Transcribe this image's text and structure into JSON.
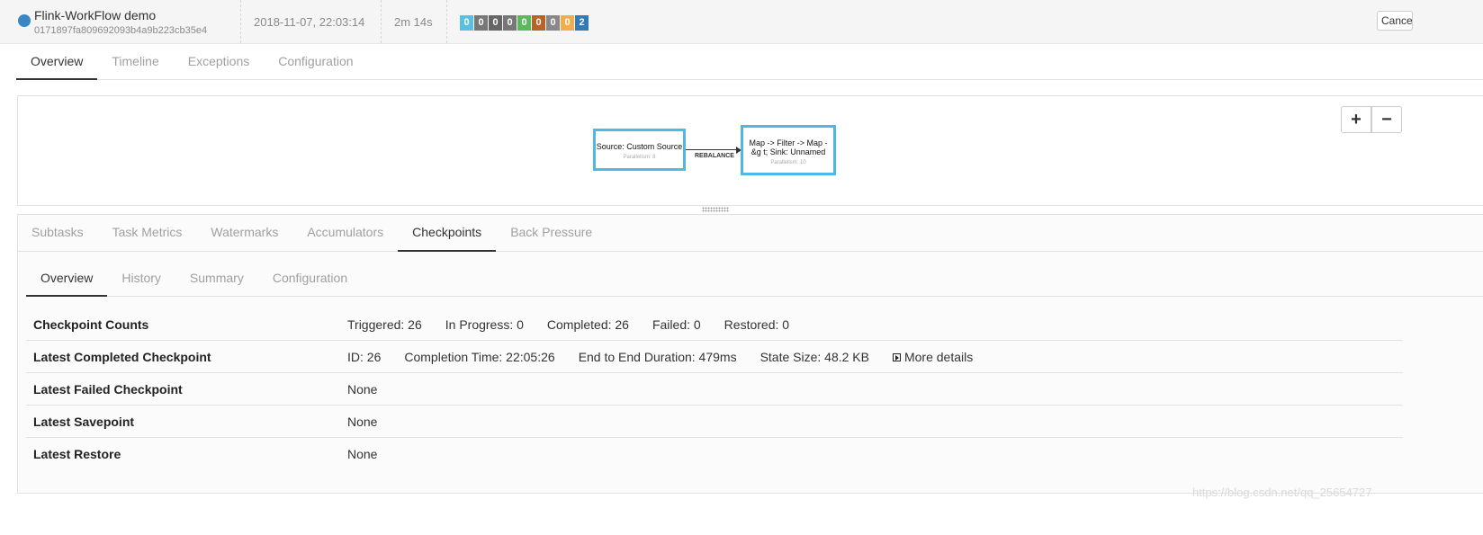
{
  "job": {
    "name": "Flink-WorkFlow demo",
    "id": "0171897fa809692093b4a9b223cb35e4",
    "start_time": "2018-11-07, 22:03:14",
    "duration": "2m 14s",
    "cancel_label": "Cancel",
    "status_color": "#3a87c5",
    "task_counts": [
      {
        "value": "0",
        "color": "#5bc0de"
      },
      {
        "value": "0",
        "color": "#777777"
      },
      {
        "value": "0",
        "color": "#666666"
      },
      {
        "value": "0",
        "color": "#777777"
      },
      {
        "value": "0",
        "color": "#5cb85c"
      },
      {
        "value": "0",
        "color": "#b7622a"
      },
      {
        "value": "0",
        "color": "#888888"
      },
      {
        "value": "0",
        "color": "#f0ad4e"
      },
      {
        "value": "2",
        "color": "#337ab7"
      }
    ]
  },
  "main_tabs": [
    {
      "label": "Overview",
      "active": true
    },
    {
      "label": "Timeline",
      "active": false
    },
    {
      "label": "Exceptions",
      "active": false
    },
    {
      "label": "Configuration",
      "active": false
    }
  ],
  "graph": {
    "zoom_in": "+",
    "zoom_out": "−",
    "nodes": [
      {
        "title": "Source: Custom Source",
        "parallelism": "Parallelism: 8"
      },
      {
        "title": "Map -> Filter -> Map -&g t; Sink: Unnamed",
        "parallelism": "Parallelism: 10"
      }
    ],
    "edge_label": "REBALANCE"
  },
  "vertex_tabs": [
    {
      "label": "Subtasks",
      "active": false
    },
    {
      "label": "Task Metrics",
      "active": false
    },
    {
      "label": "Watermarks",
      "active": false
    },
    {
      "label": "Accumulators",
      "active": false
    },
    {
      "label": "Checkpoints",
      "active": true
    },
    {
      "label": "Back Pressure",
      "active": false
    }
  ],
  "checkpoint_tabs": [
    {
      "label": "Overview",
      "active": true
    },
    {
      "label": "History",
      "active": false
    },
    {
      "label": "Summary",
      "active": false
    },
    {
      "label": "Configuration",
      "active": false
    }
  ],
  "overview": {
    "counts": {
      "label": "Checkpoint Counts",
      "triggered": "Triggered: 26",
      "in_progress": "In Progress: 0",
      "completed": "Completed: 26",
      "failed": "Failed: 0",
      "restored": "Restored: 0"
    },
    "latest_completed": {
      "label": "Latest Completed Checkpoint",
      "id": "ID: 26",
      "completion_time": "Completion Time: 22:05:26",
      "duration": "End to End Duration: 479ms",
      "state_size": "State Size: 48.2 KB",
      "more_details": "More details"
    },
    "latest_failed": {
      "label": "Latest Failed Checkpoint",
      "value": "None"
    },
    "latest_savepoint": {
      "label": "Latest Savepoint",
      "value": "None"
    },
    "latest_restore": {
      "label": "Latest Restore",
      "value": "None"
    }
  },
  "watermark": "https://blog.csdn.net/qq_25654727"
}
